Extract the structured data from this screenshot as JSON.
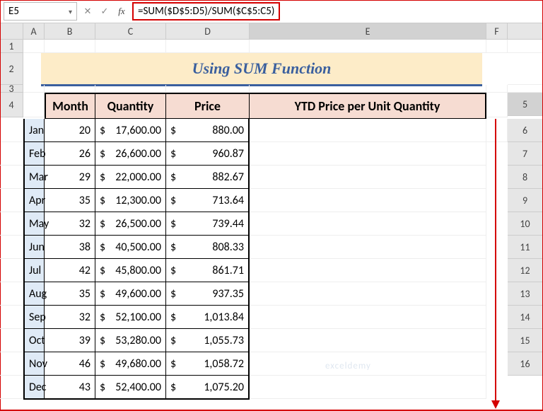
{
  "name_box": "E5",
  "formula": "=SUM($D$5:D5)/SUM($C$5:C5)",
  "columns": [
    "",
    "A",
    "B",
    "C",
    "D",
    "E",
    "F"
  ],
  "title": "Using SUM Function",
  "headers": {
    "month": "Month",
    "qty": "Quantity",
    "price": "Price",
    "ytd": "YTD Price per Unit Quantity"
  },
  "rows": [
    {
      "n": "5",
      "m": "Jan",
      "q": "20",
      "p": "17,600.00",
      "y": "880.00"
    },
    {
      "n": "6",
      "m": "Feb",
      "q": "26",
      "p": "26,600.00",
      "y": "960.87"
    },
    {
      "n": "7",
      "m": "Mar",
      "q": "29",
      "p": "22,000.00",
      "y": "882.67"
    },
    {
      "n": "8",
      "m": "Apr",
      "q": "35",
      "p": "12,300.00",
      "y": "713.64"
    },
    {
      "n": "9",
      "m": "May",
      "q": "32",
      "p": "26,500.00",
      "y": "739.44"
    },
    {
      "n": "10",
      "m": "Jun",
      "q": "38",
      "p": "40,500.00",
      "y": "808.33"
    },
    {
      "n": "11",
      "m": "Jul",
      "q": "42",
      "p": "45,800.00",
      "y": "861.71"
    },
    {
      "n": "12",
      "m": "Aug",
      "q": "35",
      "p": "49,600.00",
      "y": "937.35"
    },
    {
      "n": "13",
      "m": "Sep",
      "q": "32",
      "p": "52,100.00",
      "y": "1,013.84"
    },
    {
      "n": "14",
      "m": "Oct",
      "q": "39",
      "p": "53,280.00",
      "y": "1,055.73"
    },
    {
      "n": "15",
      "m": "Nov",
      "q": "46",
      "p": "49,680.00",
      "y": "1,058.72"
    },
    {
      "n": "16",
      "m": "Dec",
      "q": "43",
      "p": "52,400.00",
      "y": "1,075.20"
    }
  ],
  "currency": "$",
  "watermark": "exceldemy"
}
